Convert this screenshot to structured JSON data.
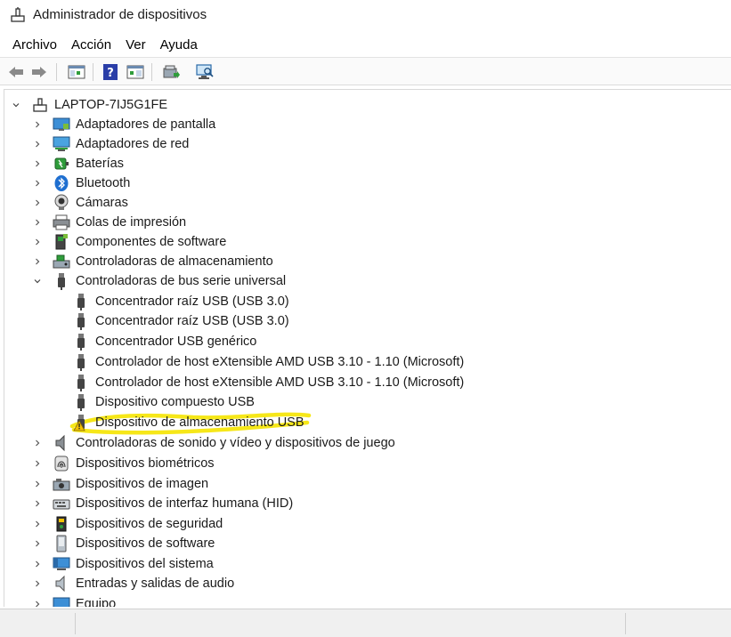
{
  "window": {
    "title": "Administrador de dispositivos"
  },
  "menu": [
    "Archivo",
    "Acción",
    "Ver",
    "Ayuda"
  ],
  "toolbar": {
    "buttons": [
      "back-arrow-icon",
      "forward-arrow-icon",
      "properties-pane-icon",
      "help-icon",
      "action-pane-icon",
      "update-driver-icon",
      "scan-hardware-icon"
    ]
  },
  "tree": {
    "root": "LAPTOP-7IJ5G1FE",
    "categories": [
      {
        "label": "Adaptadores de pantalla",
        "icon": "display-adapter-icon",
        "expanded": false
      },
      {
        "label": "Adaptadores de red",
        "icon": "network-adapter-icon",
        "expanded": false
      },
      {
        "label": "Baterías",
        "icon": "battery-icon",
        "expanded": false
      },
      {
        "label": "Bluetooth",
        "icon": "bluetooth-icon",
        "expanded": false
      },
      {
        "label": "Cámaras",
        "icon": "camera-icon",
        "expanded": false
      },
      {
        "label": "Colas de impresión",
        "icon": "printer-icon",
        "expanded": false
      },
      {
        "label": "Componentes de software",
        "icon": "software-component-icon",
        "expanded": false
      },
      {
        "label": "Controladoras de almacenamiento",
        "icon": "storage-controller-icon",
        "expanded": false
      },
      {
        "label": "Controladoras de bus serie universal",
        "icon": "usb-icon",
        "expanded": true
      },
      {
        "label": "Controladoras de sonido y vídeo y dispositivos de juego",
        "icon": "speaker-icon",
        "expanded": false
      },
      {
        "label": "Dispositivos biométricos",
        "icon": "fingerprint-icon",
        "expanded": false
      },
      {
        "label": "Dispositivos de imagen",
        "icon": "imaging-device-icon",
        "expanded": false
      },
      {
        "label": "Dispositivos de interfaz humana (HID)",
        "icon": "hid-icon",
        "expanded": false
      },
      {
        "label": "Dispositivos de seguridad",
        "icon": "security-device-icon",
        "expanded": false
      },
      {
        "label": "Dispositivos de software",
        "icon": "software-device-icon",
        "expanded": false
      },
      {
        "label": "Dispositivos del sistema",
        "icon": "system-device-icon",
        "expanded": false
      },
      {
        "label": "Entradas y salidas de audio",
        "icon": "audio-io-icon",
        "expanded": false
      },
      {
        "label": "Equipo",
        "icon": "computer-icon",
        "expanded": false
      }
    ],
    "usb_children": [
      {
        "label": "Concentrador raíz USB (USB 3.0)",
        "warning": false
      },
      {
        "label": "Concentrador raíz USB (USB 3.0)",
        "warning": false
      },
      {
        "label": "Concentrador USB genérico",
        "warning": false
      },
      {
        "label": "Controlador de host eXtensible AMD USB 3.10 - 1.10 (Microsoft)",
        "warning": false
      },
      {
        "label": "Controlador de host eXtensible AMD USB 3.10 - 1.10 (Microsoft)",
        "warning": false
      },
      {
        "label": "Dispositivo compuesto USB",
        "warning": false
      },
      {
        "label": "Dispositivo de almacenamiento USB",
        "warning": true
      }
    ]
  },
  "colors": {
    "highlight": "#f5e400",
    "warning": "#f2c200",
    "accent": "#1f6fd0"
  }
}
